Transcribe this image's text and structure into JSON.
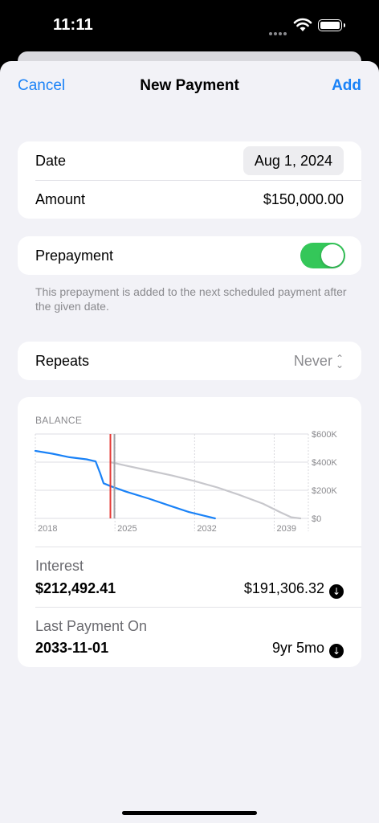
{
  "status": {
    "time": "11:11"
  },
  "nav": {
    "cancel": "Cancel",
    "title": "New Payment",
    "add": "Add"
  },
  "form": {
    "date_label": "Date",
    "date_value": "Aug 1, 2024",
    "amount_label": "Amount",
    "amount_value": "$150,000.00",
    "prepayment_label": "Prepayment",
    "prepayment_on": true,
    "prepayment_note": "This prepayment is added to the next scheduled payment after the given date.",
    "repeats_label": "Repeats",
    "repeats_value": "Never"
  },
  "chart_data": {
    "type": "line",
    "title": "BALANCE",
    "x_ticks": [
      "2018",
      "2025",
      "2032",
      "2039"
    ],
    "y_ticks": [
      "$600K",
      "$400K",
      "$200K",
      "$0"
    ],
    "ylim": [
      0,
      600000
    ],
    "xlim": [
      2018,
      2042
    ],
    "marker_date": 2024.6,
    "series": [
      {
        "color": "#1a82f7",
        "x": [
          2018,
          2019.5,
          2021,
          2022.5,
          2023.3,
          2023.7,
          2024.0,
          2024.6,
          2026,
          2028,
          2030,
          2031.5,
          2033.8
        ],
        "y": [
          480000,
          460000,
          435000,
          420000,
          405000,
          320000,
          250000,
          230000,
          190000,
          140000,
          85000,
          45000,
          0
        ]
      },
      {
        "color": "#c7c7cc",
        "x": [
          2024.6,
          2026,
          2028,
          2030,
          2032,
          2034,
          2036,
          2038,
          2039.5,
          2040.5,
          2041.3
        ],
        "y": [
          400000,
          375000,
          340000,
          305000,
          265000,
          220000,
          165000,
          105000,
          45000,
          8000,
          0
        ]
      }
    ],
    "grid": true
  },
  "stats": {
    "interest_label": "Interest",
    "interest_value": "$212,492.41",
    "interest_new": "$191,306.32",
    "last_label": "Last Payment On",
    "last_value": "2033-11-01",
    "last_new": "9yr 5mo"
  },
  "icons": {
    "down": "arrow-down-circle-icon"
  }
}
